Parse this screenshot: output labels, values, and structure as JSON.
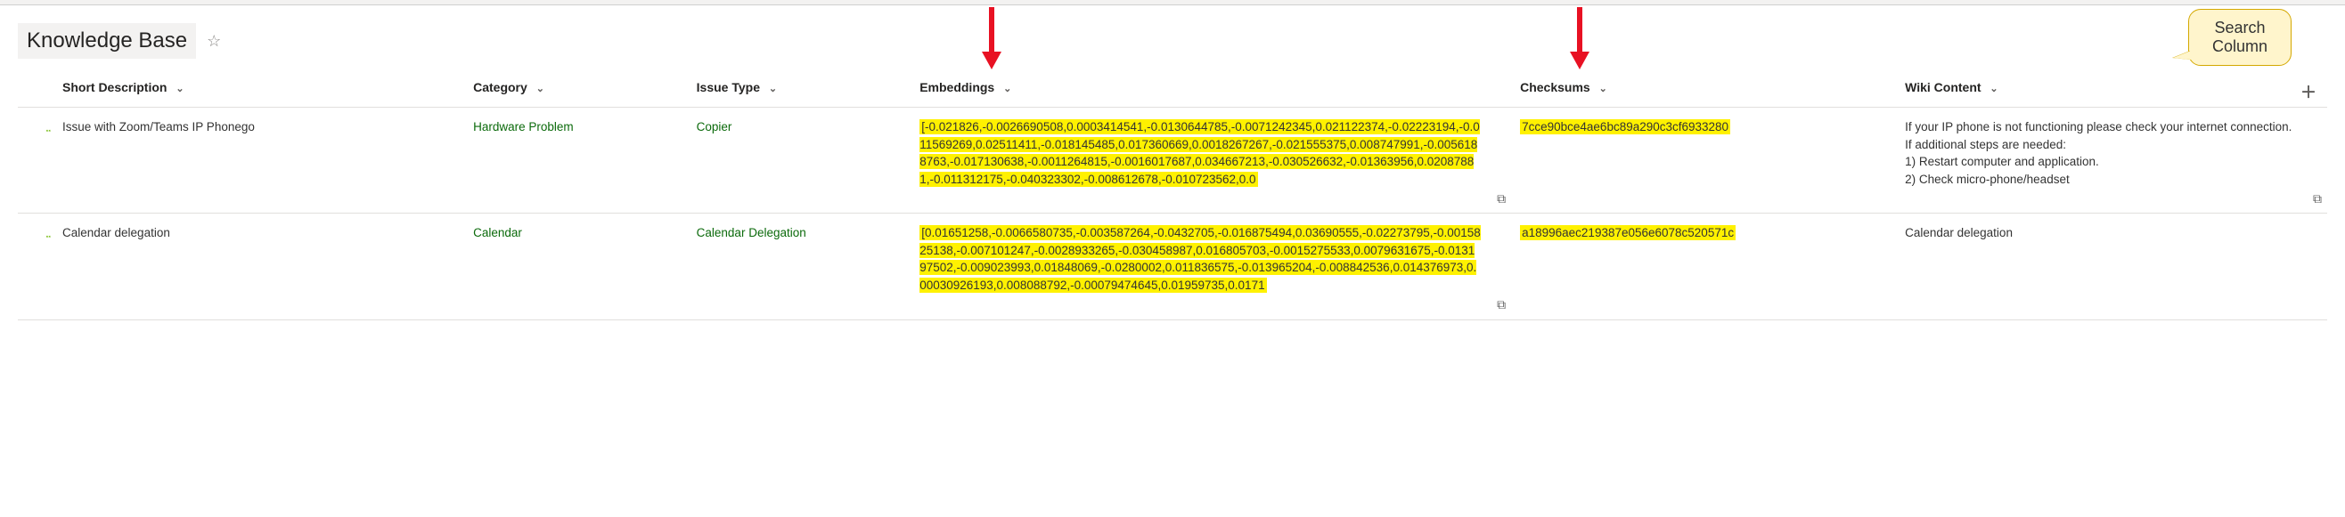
{
  "header": {
    "title": "Knowledge Base"
  },
  "callout": {
    "line1": "Search",
    "line2": "Column"
  },
  "columns": {
    "short_desc": "Short Description",
    "category": "Category",
    "issue_type": "Issue Type",
    "embeddings": "Embeddings",
    "checksums": "Checksums",
    "wiki_content": "Wiki Content"
  },
  "rows": [
    {
      "short_desc": "Issue with Zoom/Teams IP Phonego",
      "category": "Hardware Problem",
      "issue_type": "Copier",
      "embeddings": "[-0.021826,-0.0026690508,0.0003414541,-0.0130644785,-0.0071242345,0.021122374,-0.02223194,-0.011569269,0.02511411,-0.018145485,0.017360669,0.0018267267,-0.021555375,0.008747991,-0.0056188763,-0.017130638,-0.0011264815,-0.0016017687,0.034667213,-0.030526632,-0.01363956,0.02087881,-0.011312175,-0.040323302,-0.008612678,-0.010723562,0.0",
      "checksum": "7cce90bce4ae6bc89a290c3cf6933280",
      "wiki": "If your IP phone is not functioning please check your internet connection.\nIf additional steps are needed:\n1) Restart computer and application.\n2) Check micro-phone/headset"
    },
    {
      "short_desc": "Calendar delegation",
      "category": "Calendar",
      "issue_type": "Calendar Delegation",
      "embeddings": "[0.01651258,-0.0066580735,-0.003587264,-0.0432705,-0.016875494,0.03690555,-0.02273795,-0.0015825138,-0.007101247,-0.0028933265,-0.030458987,0.016805703,-0.0015275533,0.0079631675,-0.013197502,-0.009023993,0.01848069,-0.0280002,0.011836575,-0.013965204,-0.008842536,0.014376973,0.00030926193,0.008088792,-0.00079474645,0.01959735,0.0171",
      "checksum": "a18996aec219387e056e6078c520571c",
      "wiki": "Calendar delegation"
    }
  ]
}
